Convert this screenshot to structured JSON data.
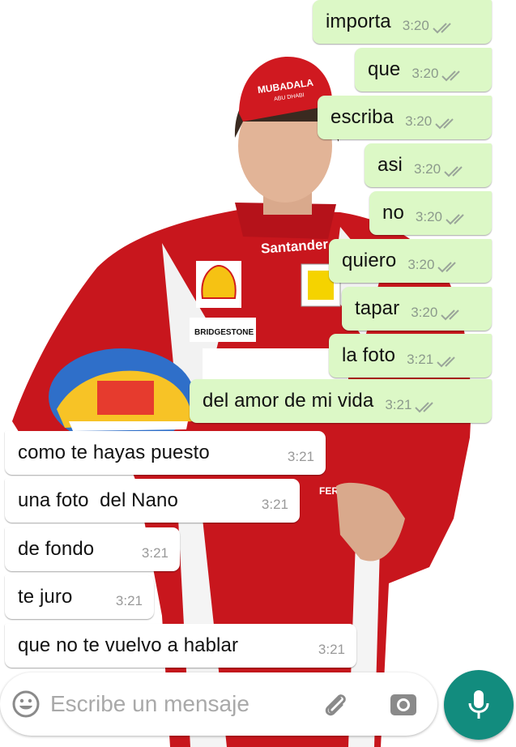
{
  "chat": {
    "sent": [
      {
        "text": "importa",
        "time": "3:20"
      },
      {
        "text": "que",
        "time": "3:20"
      },
      {
        "text": "escriba",
        "time": "3:20"
      },
      {
        "text": "asi",
        "time": "3:20"
      },
      {
        "text": "no",
        "time": "3:20"
      },
      {
        "text": "quiero",
        "time": "3:20"
      },
      {
        "text": "tapar",
        "time": "3:20"
      },
      {
        "text": "la foto",
        "time": "3:21"
      },
      {
        "text": "del amor de mi vida",
        "time": "3:21"
      }
    ],
    "received": [
      {
        "text": "como te hayas puesto",
        "time": "3:21"
      },
      {
        "text": "una foto  del Nano",
        "time": "3:21"
      },
      {
        "text": "de fondo",
        "time": "3:21"
      },
      {
        "text": "te juro",
        "time": "3:21"
      },
      {
        "text": "que no te vuelvo a hablar",
        "time": "3:21"
      }
    ]
  },
  "wallpaper": {
    "cap_text": "MUBADALA",
    "cap_subtext": "ABU DHABI",
    "chest_sponsor": "Santander",
    "patch_text": "BRIDGESTONE",
    "sleeve_text": "FERRARI"
  },
  "composer": {
    "placeholder": "Escribe un mensaje",
    "value": ""
  },
  "colors": {
    "outgoing_bubble": "#dcf8c6",
    "incoming_bubble": "#ffffff",
    "mic_button": "#128c7e",
    "suit_red": "#c8161d"
  }
}
